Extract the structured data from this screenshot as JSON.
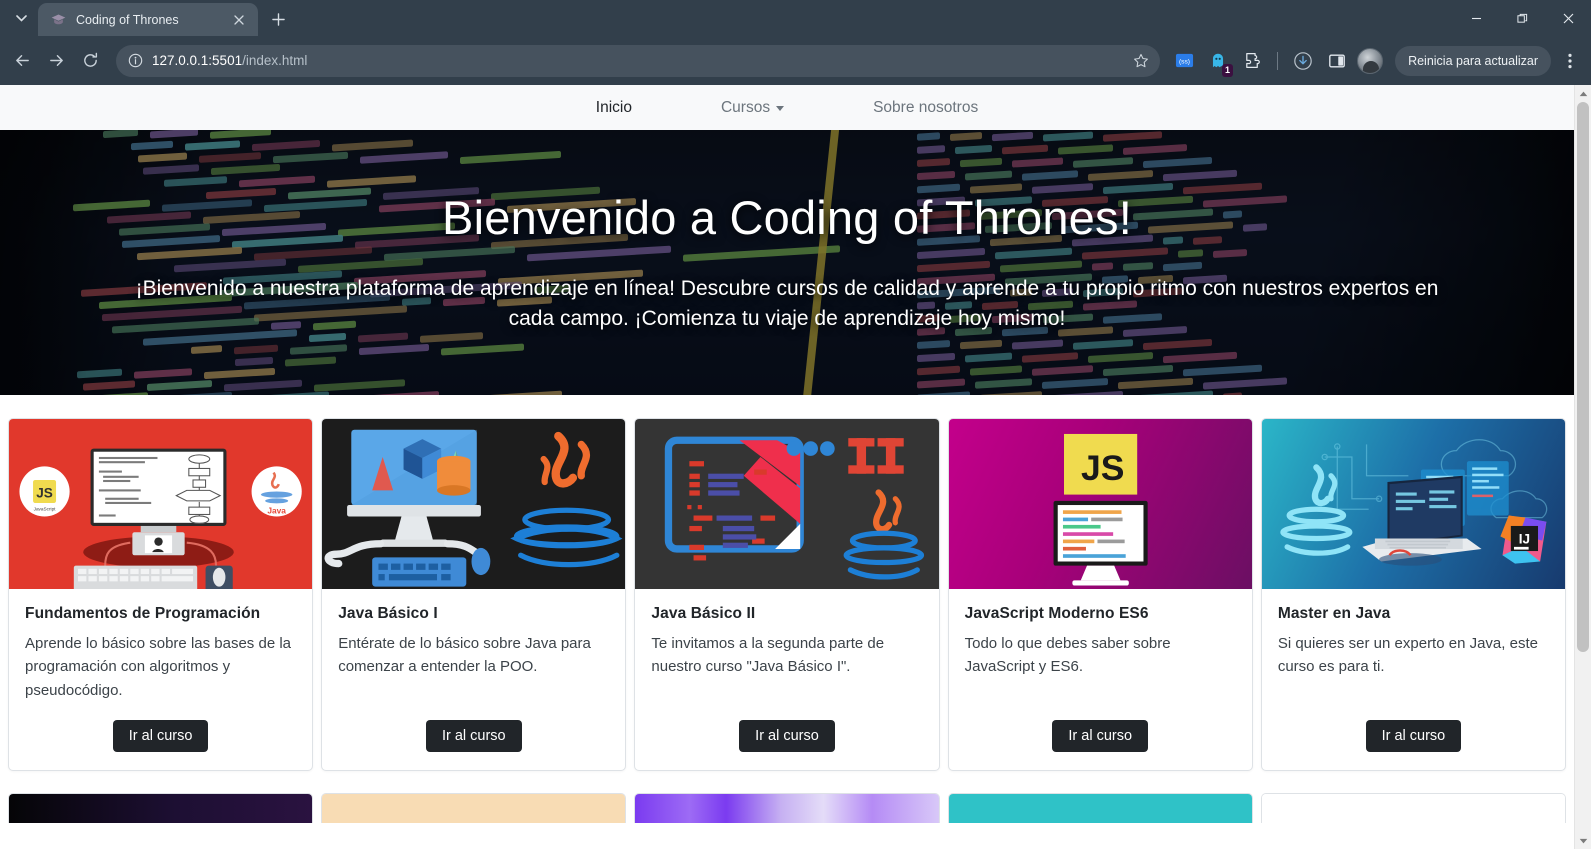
{
  "browser": {
    "tab": {
      "title": "Coding of Thrones",
      "favicon_icon": "graduation-cap-icon",
      "close_icon": "close-icon"
    },
    "tab_list_icon": "chevron-down-icon",
    "new_tab_icon": "plus-icon",
    "window_controls": {
      "minimize": "minimize-icon",
      "maximize": "maximize-icon",
      "close": "close-icon"
    },
    "nav": {
      "back_icon": "arrow-left-icon",
      "forward_icon": "arrow-right-icon",
      "reload_icon": "reload-icon"
    },
    "omnibox": {
      "info_icon": "info-circle-icon",
      "url_host": "127.0.0.1:5501",
      "url_path": "/index.html",
      "url_full": "127.0.0.1:5501/index.html",
      "bookmark_icon": "star-icon"
    },
    "extensions": [
      {
        "name": "css-extension-icon",
        "label": "css",
        "badge": ""
      },
      {
        "name": "ghost-extension-icon",
        "label": "",
        "badge": "1"
      },
      {
        "name": "extensions-puzzle-icon",
        "label": "",
        "badge": ""
      }
    ],
    "downloads_icon": "download-icon",
    "side_panel_icon": "side-panel-icon",
    "profile_icon": "avatar",
    "update_button_label": "Reinicia para actualizar",
    "menu_icon": "three-dots-vertical-icon",
    "scrollbar": {
      "up_icon": "scroll-up-arrow",
      "down_icon": "scroll-down-arrow"
    }
  },
  "site": {
    "nav": {
      "items": [
        {
          "label": "Inicio",
          "active": true,
          "has_caret": false
        },
        {
          "label": "Cursos",
          "active": false,
          "has_caret": true
        },
        {
          "label": "Sobre nosotros",
          "active": false,
          "has_caret": false
        }
      ]
    },
    "hero": {
      "title": "Bienvenido a Coding of Thrones!",
      "subtitle": "¡Bienvenido a nuestra plataforma de aprendizaje en línea! Descubre cursos de calidad y aprende a tu propio ritmo con nuestros expertos en cada campo. ¡Comienza tu viaje de aprendizaje hoy mismo!"
    },
    "courses": [
      {
        "title": "Fundamentos de Programación",
        "description": "Aprende lo básico sobre las bases de la programación con algoritmos y pseudocódigo.",
        "button": "Ir al curso",
        "image_name": "fundamentos-programacion-thumbnail",
        "image_bg": "#e1382c"
      },
      {
        "title": "Java Básico I",
        "description": "Entérate de lo básico sobre Java para comenzar a entender la POO.",
        "button": "Ir al curso",
        "image_name": "java-basico-1-thumbnail",
        "image_bg": "#1c1c1c"
      },
      {
        "title": "Java Básico II",
        "description": "Te invitamos a la segunda parte de nuestro curso \"Java Básico I\".",
        "button": "Ir al curso",
        "image_name": "java-basico-2-thumbnail",
        "image_bg": "#343434"
      },
      {
        "title": "JavaScript Moderno ES6",
        "description": "Todo lo que debes saber sobre JavaScript y ES6.",
        "button": "Ir al curso",
        "image_name": "javascript-es6-thumbnail",
        "image_bg": "#a8007a"
      },
      {
        "title": "Master en Java",
        "description": "Si quieres ser un experto en Java, este curso es para ti.",
        "button": "Ir al curso",
        "image_name": "master-en-java-thumbnail",
        "image_bg": "#1d6fa8"
      }
    ],
    "courses_row2_peek": [
      {
        "image_name": "course-thumbnail-dark",
        "image_bg": "#150a28"
      },
      {
        "image_name": "course-thumbnail-peach",
        "image_bg": "#f8dcb4"
      },
      {
        "image_name": "course-thumbnail-purple",
        "image_bg": "#8a4df0"
      },
      {
        "image_name": "course-thumbnail-teal",
        "image_bg": "#2fc2c7"
      },
      {
        "image_name": "course-thumbnail-empty",
        "image_bg": "#ffffff"
      }
    ]
  },
  "colors": {
    "chrome_bg": "#323f4b",
    "tab_active": "#4c5965",
    "site_nav_bg": "#f8f9fa",
    "button_dark": "#212529",
    "text_muted": "#6c757d",
    "card_border": "#dee2e6"
  }
}
